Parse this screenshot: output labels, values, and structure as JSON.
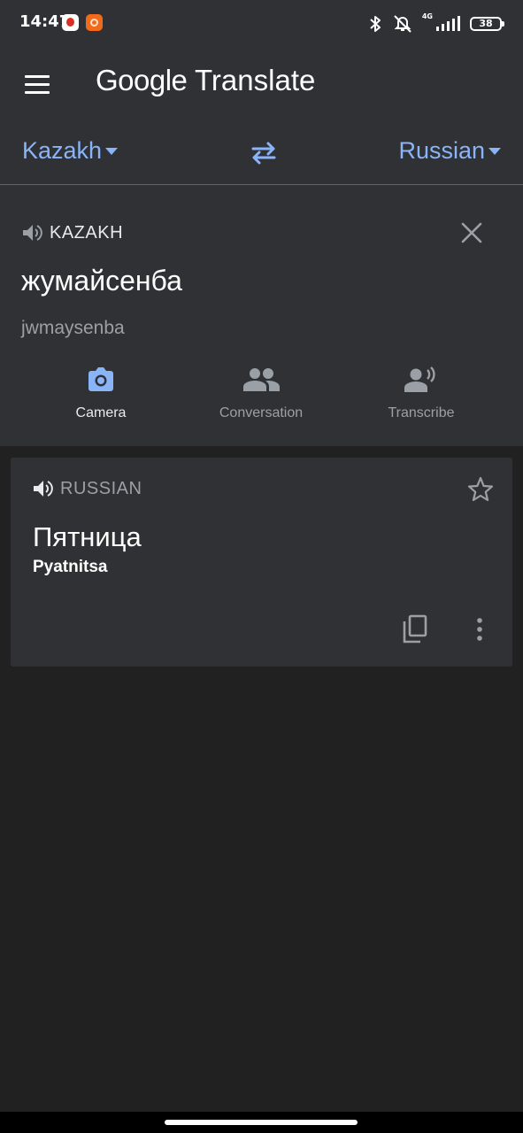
{
  "status_bar": {
    "time": "14:47",
    "network_label": "4G",
    "battery_level": "38",
    "icons": [
      "notification-app-icon",
      "notification-app-icon",
      "bluetooth-icon",
      "vibrate-off-icon",
      "signal-icon",
      "battery-icon"
    ]
  },
  "app_bar": {
    "brand": "Google",
    "product": "Translate",
    "menu_icon": "hamburger-menu-icon"
  },
  "language_bar": {
    "source_language": "Kazakh",
    "target_language": "Russian",
    "swap_icon": "swap-arrows-icon",
    "accent_color": "#8ab4f8"
  },
  "input": {
    "language_label": "KAZAKH",
    "text": "жумайсенба",
    "transliteration": "jwmaysenba",
    "tools": [
      {
        "label": "Camera",
        "icon": "camera-icon",
        "active": true
      },
      {
        "label": "Conversation",
        "icon": "people-icon",
        "active": false
      },
      {
        "label": "Transcribe",
        "icon": "transcribe-icon",
        "active": false
      }
    ]
  },
  "result": {
    "language_label": "RUSSIAN",
    "text": "Пятница",
    "transliteration": "Pyatnitsa",
    "actions": [
      "star-icon",
      "copy-icon",
      "more-vert-icon"
    ]
  },
  "colors": {
    "background": "#212121",
    "surface": "#303134",
    "camera_icon": "#8ab4f8",
    "inactive_icon": "#9aa0a6"
  }
}
